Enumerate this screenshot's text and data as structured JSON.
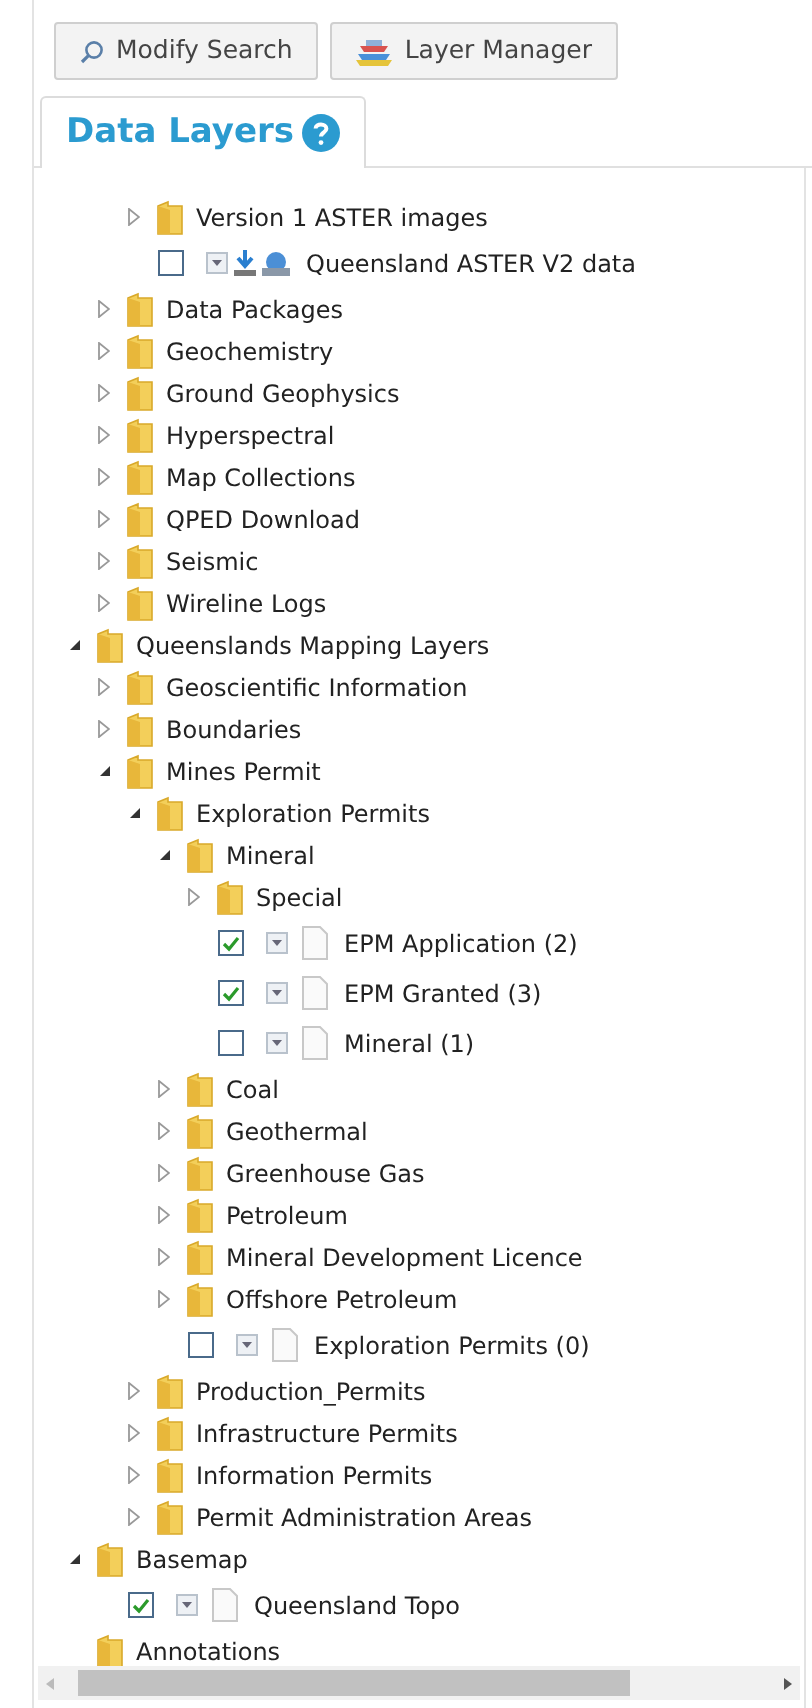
{
  "toolbar": [
    {
      "kind": "search",
      "label": "Modify Search"
    },
    {
      "kind": "layers",
      "label": "Layer Manager"
    }
  ],
  "tabs": [
    {
      "label": "Data Layers",
      "selected": true
    }
  ],
  "tree": [
    {
      "kind": "scrolled_off",
      "children": [
        {
          "kind": "scrolled_off",
          "children": [
            {
              "kind": "folder",
              "label": "Version 1 ASTER images",
              "expanded": false
            },
            {
              "kind": "download_leaf",
              "label": "Queensland ASTER V2 data",
              "checked": false
            }
          ]
        },
        {
          "kind": "folder",
          "label": "Data Packages",
          "expanded": false
        },
        {
          "kind": "folder",
          "label": "Geochemistry",
          "expanded": false
        },
        {
          "kind": "folder",
          "label": "Ground Geophysics",
          "expanded": false
        },
        {
          "kind": "folder",
          "label": "Hyperspectral",
          "expanded": false
        },
        {
          "kind": "folder",
          "label": "Map Collections",
          "expanded": false
        },
        {
          "kind": "folder",
          "label": "QPED Download",
          "expanded": false
        },
        {
          "kind": "folder",
          "label": "Seismic",
          "expanded": false
        },
        {
          "kind": "folder",
          "label": "Wireline Logs",
          "expanded": false
        }
      ]
    },
    {
      "kind": "folder",
      "label": "Queenslands Mapping Layers",
      "expanded": true,
      "children": [
        {
          "kind": "folder",
          "label": "Geoscientific Information",
          "expanded": false
        },
        {
          "kind": "folder",
          "label": "Boundaries",
          "expanded": false
        },
        {
          "kind": "folder",
          "label": "Mines Permit",
          "expanded": true,
          "children": [
            {
              "kind": "folder",
              "label": "Exploration Permits",
              "expanded": true,
              "children": [
                {
                  "kind": "folder",
                  "label": "Mineral",
                  "expanded": true,
                  "children": [
                    {
                      "kind": "folder",
                      "label": "Special",
                      "expanded": false
                    },
                    {
                      "kind": "leaf",
                      "label": "EPM Application (2)",
                      "checked": true
                    },
                    {
                      "kind": "leaf",
                      "label": "EPM Granted (3)",
                      "checked": true
                    },
                    {
                      "kind": "leaf",
                      "label": "Mineral (1)",
                      "checked": false
                    }
                  ]
                },
                {
                  "kind": "folder",
                  "label": "Coal",
                  "expanded": false
                },
                {
                  "kind": "folder",
                  "label": "Geothermal",
                  "expanded": false
                },
                {
                  "kind": "folder",
                  "label": "Greenhouse Gas",
                  "expanded": false
                },
                {
                  "kind": "folder",
                  "label": "Petroleum",
                  "expanded": false
                },
                {
                  "kind": "folder",
                  "label": "Mineral Development Licence",
                  "expanded": false
                },
                {
                  "kind": "folder",
                  "label": "Offshore Petroleum",
                  "expanded": false
                },
                {
                  "kind": "leaf",
                  "label": "Exploration Permits (0)",
                  "checked": false
                }
              ]
            },
            {
              "kind": "folder",
              "label": "Production_Permits",
              "expanded": false
            },
            {
              "kind": "folder",
              "label": "Infrastructure Permits",
              "expanded": false
            },
            {
              "kind": "folder",
              "label": "Information Permits",
              "expanded": false
            },
            {
              "kind": "folder",
              "label": "Permit Administration Areas",
              "expanded": false
            }
          ]
        }
      ]
    },
    {
      "kind": "folder",
      "label": "Basemap",
      "expanded": true,
      "children": [
        {
          "kind": "leaf",
          "label": "Queensland Topo",
          "checked": true
        }
      ]
    },
    {
      "kind": "folder",
      "label": "Annotations"
    }
  ]
}
